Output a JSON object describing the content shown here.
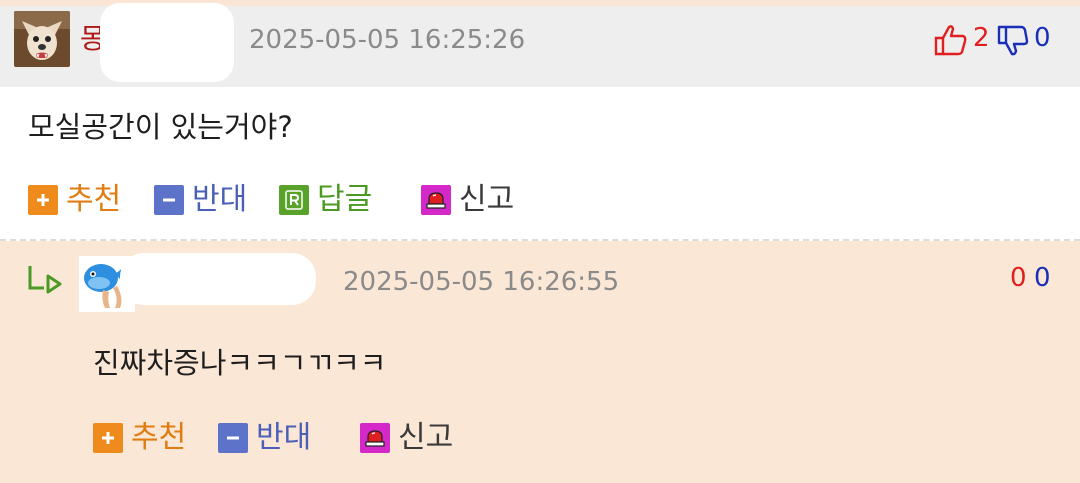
{
  "comments": [
    {
      "nickname_visible": "몽",
      "timestamp": "2025-05-05 16:25:26",
      "upvotes": "2",
      "downvotes": "0",
      "body": "모실공간이 있는거야?",
      "actions": {
        "recommend": "추천",
        "oppose": "반대",
        "reply": "답글",
        "report": "신고"
      },
      "avatar_icon": "dog-avatar-icon"
    },
    {
      "timestamp": "2025-05-05 16:26:55",
      "upvotes": "0",
      "downvotes": "0",
      "body": "진짜차증나ㅋㅋㄱㄲㅋㅋ",
      "actions": {
        "recommend": "추천",
        "oppose": "반대",
        "report": "신고"
      },
      "avatar_icon": "blue-fish-avatar-icon"
    }
  ],
  "colors": {
    "header_gray": "#eeeeee",
    "reply_bg": "#fbe7d6",
    "recommend": "#ef8a1c",
    "oppose": "#5d72c9",
    "reply": "#5aa32a",
    "report": "#d528c9",
    "upvote_red": "#e02020",
    "downvote_blue": "#1a2fb8"
  }
}
